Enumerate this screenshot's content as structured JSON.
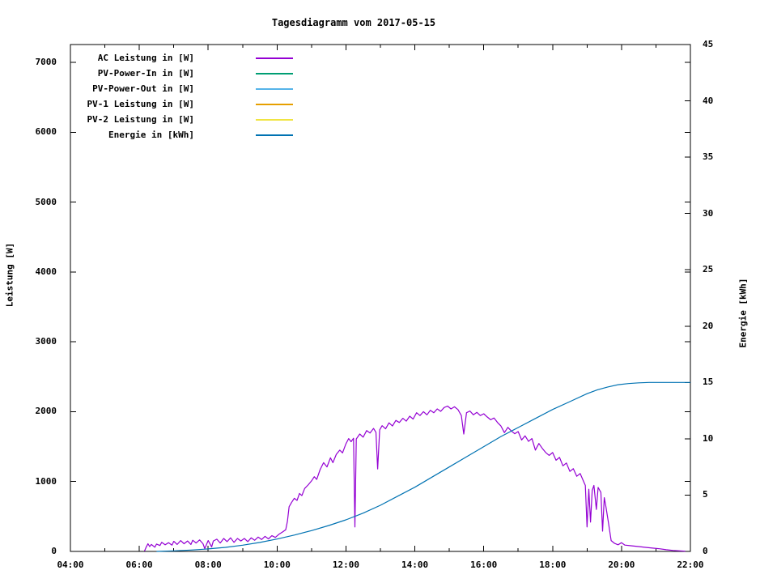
{
  "chart_data": {
    "type": "line",
    "title": "Tagesdiagramm vom 2017-05-15",
    "grid": false,
    "legend_position": "inside top-left",
    "x_axis": {
      "unit": "time of day",
      "range_hours": [
        4,
        22
      ],
      "major_tick_hours": [
        4,
        6,
        8,
        10,
        12,
        14,
        16,
        18,
        20,
        22
      ],
      "major_tick_labels": [
        "04:00",
        "06:00",
        "08:00",
        "10:00",
        "12:00",
        "14:00",
        "16:00",
        "18:00",
        "20:00",
        "22:00"
      ],
      "minor_tick_every_hours": 1
    },
    "y_axis_left": {
      "label": "Leistung [W]",
      "range": [
        0,
        7250
      ],
      "tick_values": [
        0,
        1000,
        2000,
        3000,
        4000,
        5000,
        6000,
        7000
      ]
    },
    "y_axis_right": {
      "label": "Energie [kWh]",
      "range": [
        0,
        45
      ],
      "tick_values": [
        0,
        5,
        10,
        15,
        20,
        25,
        30,
        35,
        40,
        45
      ]
    },
    "series": [
      {
        "name": "AC Leistung in [W]",
        "color": "#9400d3",
        "axis": "left",
        "visible": true,
        "points": [
          [
            6.15,
            5
          ],
          [
            6.2,
            60
          ],
          [
            6.25,
            110
          ],
          [
            6.3,
            70
          ],
          [
            6.35,
            100
          ],
          [
            6.45,
            60
          ],
          [
            6.5,
            105
          ],
          [
            6.6,
            85
          ],
          [
            6.65,
            130
          ],
          [
            6.75,
            95
          ],
          [
            6.85,
            125
          ],
          [
            6.95,
            90
          ],
          [
            7.0,
            145
          ],
          [
            7.1,
            100
          ],
          [
            7.2,
            155
          ],
          [
            7.3,
            110
          ],
          [
            7.4,
            150
          ],
          [
            7.5,
            100
          ],
          [
            7.55,
            160
          ],
          [
            7.65,
            120
          ],
          [
            7.75,
            165
          ],
          [
            7.85,
            110
          ],
          [
            7.9,
            40
          ],
          [
            8.0,
            155
          ],
          [
            8.1,
            65
          ],
          [
            8.15,
            150
          ],
          [
            8.25,
            175
          ],
          [
            8.35,
            120
          ],
          [
            8.45,
            185
          ],
          [
            8.55,
            140
          ],
          [
            8.65,
            195
          ],
          [
            8.75,
            130
          ],
          [
            8.85,
            185
          ],
          [
            8.95,
            150
          ],
          [
            9.05,
            185
          ],
          [
            9.15,
            140
          ],
          [
            9.25,
            195
          ],
          [
            9.35,
            160
          ],
          [
            9.45,
            205
          ],
          [
            9.55,
            170
          ],
          [
            9.65,
            215
          ],
          [
            9.75,
            180
          ],
          [
            9.85,
            225
          ],
          [
            9.95,
            200
          ],
          [
            10.05,
            245
          ],
          [
            10.15,
            275
          ],
          [
            10.25,
            310
          ],
          [
            10.3,
            430
          ],
          [
            10.35,
            640
          ],
          [
            10.42,
            700
          ],
          [
            10.5,
            760
          ],
          [
            10.58,
            730
          ],
          [
            10.65,
            830
          ],
          [
            10.72,
            800
          ],
          [
            10.8,
            900
          ],
          [
            10.9,
            950
          ],
          [
            11.0,
            1010
          ],
          [
            11.08,
            1070
          ],
          [
            11.15,
            1030
          ],
          [
            11.25,
            1170
          ],
          [
            11.35,
            1270
          ],
          [
            11.45,
            1210
          ],
          [
            11.55,
            1340
          ],
          [
            11.62,
            1270
          ],
          [
            11.72,
            1390
          ],
          [
            11.82,
            1450
          ],
          [
            11.9,
            1410
          ],
          [
            12.0,
            1540
          ],
          [
            12.08,
            1615
          ],
          [
            12.15,
            1570
          ],
          [
            12.22,
            1620
          ],
          [
            12.26,
            350
          ],
          [
            12.3,
            1610
          ],
          [
            12.4,
            1680
          ],
          [
            12.5,
            1635
          ],
          [
            12.6,
            1730
          ],
          [
            12.7,
            1695
          ],
          [
            12.8,
            1760
          ],
          [
            12.87,
            1705
          ],
          [
            12.92,
            1180
          ],
          [
            12.98,
            1740
          ],
          [
            13.05,
            1800
          ],
          [
            13.15,
            1755
          ],
          [
            13.25,
            1840
          ],
          [
            13.35,
            1795
          ],
          [
            13.45,
            1875
          ],
          [
            13.55,
            1845
          ],
          [
            13.65,
            1905
          ],
          [
            13.75,
            1865
          ],
          [
            13.85,
            1935
          ],
          [
            13.95,
            1895
          ],
          [
            14.05,
            1985
          ],
          [
            14.15,
            1945
          ],
          [
            14.25,
            2000
          ],
          [
            14.35,
            1955
          ],
          [
            14.45,
            2020
          ],
          [
            14.55,
            1985
          ],
          [
            14.65,
            2040
          ],
          [
            14.75,
            2005
          ],
          [
            14.85,
            2060
          ],
          [
            14.95,
            2080
          ],
          [
            15.05,
            2040
          ],
          [
            15.15,
            2070
          ],
          [
            15.25,
            2030
          ],
          [
            15.35,
            1945
          ],
          [
            15.42,
            1680
          ],
          [
            15.5,
            1985
          ],
          [
            15.6,
            2010
          ],
          [
            15.7,
            1955
          ],
          [
            15.8,
            1990
          ],
          [
            15.9,
            1945
          ],
          [
            16.0,
            1970
          ],
          [
            16.1,
            1925
          ],
          [
            16.2,
            1885
          ],
          [
            16.3,
            1910
          ],
          [
            16.4,
            1845
          ],
          [
            16.5,
            1795
          ],
          [
            16.6,
            1700
          ],
          [
            16.7,
            1775
          ],
          [
            16.8,
            1725
          ],
          [
            16.9,
            1685
          ],
          [
            17.0,
            1715
          ],
          [
            17.1,
            1595
          ],
          [
            17.2,
            1655
          ],
          [
            17.3,
            1575
          ],
          [
            17.4,
            1615
          ],
          [
            17.5,
            1450
          ],
          [
            17.6,
            1545
          ],
          [
            17.7,
            1475
          ],
          [
            17.8,
            1415
          ],
          [
            17.9,
            1375
          ],
          [
            18.0,
            1415
          ],
          [
            18.1,
            1305
          ],
          [
            18.2,
            1345
          ],
          [
            18.3,
            1225
          ],
          [
            18.4,
            1265
          ],
          [
            18.5,
            1145
          ],
          [
            18.6,
            1185
          ],
          [
            18.7,
            1075
          ],
          [
            18.8,
            1115
          ],
          [
            18.9,
            1000
          ],
          [
            18.95,
            945
          ],
          [
            19.0,
            350
          ],
          [
            19.05,
            890
          ],
          [
            19.1,
            420
          ],
          [
            19.15,
            875
          ],
          [
            19.2,
            945
          ],
          [
            19.27,
            600
          ],
          [
            19.32,
            915
          ],
          [
            19.4,
            845
          ],
          [
            19.45,
            290
          ],
          [
            19.5,
            770
          ],
          [
            19.55,
            635
          ],
          [
            19.62,
            415
          ],
          [
            19.7,
            155
          ],
          [
            19.8,
            115
          ],
          [
            19.9,
            95
          ],
          [
            20.0,
            125
          ],
          [
            20.1,
            90
          ],
          [
            20.3,
            80
          ],
          [
            20.5,
            70
          ],
          [
            20.7,
            58
          ],
          [
            20.9,
            48
          ],
          [
            21.1,
            38
          ],
          [
            21.3,
            24
          ],
          [
            21.5,
            14
          ],
          [
            21.7,
            8
          ],
          [
            21.85,
            4
          ]
        ]
      },
      {
        "name": "PV-Power-In in [W]",
        "color": "#009e73",
        "axis": "left",
        "visible": false,
        "note": "no visible trace (stays at 0 W along the x-axis)",
        "points": []
      },
      {
        "name": "PV-Power-Out in [W]",
        "color": "#56b4e9",
        "axis": "left",
        "visible": false,
        "note": "no visible trace (stays at 0 W along the x-axis)",
        "points": []
      },
      {
        "name": "PV-1 Leistung in [W]",
        "color": "#e69f00",
        "axis": "left",
        "visible": false,
        "note": "no visible trace (stays at 0 W along the x-axis)",
        "points": []
      },
      {
        "name": "PV-2 Leistung in [W]",
        "color": "#f0e442",
        "axis": "left",
        "visible": false,
        "note": "no visible trace (stays at 0 W along the x-axis)",
        "points": []
      },
      {
        "name": "Energie in [kWh]",
        "color": "#0072b2",
        "axis": "right",
        "visible": true,
        "points": [
          [
            6.5,
            0
          ],
          [
            7.0,
            0.05
          ],
          [
            7.5,
            0.12
          ],
          [
            8.0,
            0.22
          ],
          [
            8.5,
            0.36
          ],
          [
            9.0,
            0.55
          ],
          [
            9.5,
            0.8
          ],
          [
            10.0,
            1.1
          ],
          [
            10.5,
            1.45
          ],
          [
            11.0,
            1.85
          ],
          [
            11.5,
            2.3
          ],
          [
            12.0,
            2.8
          ],
          [
            12.5,
            3.4
          ],
          [
            13.0,
            4.1
          ],
          [
            13.5,
            4.9
          ],
          [
            14.0,
            5.7
          ],
          [
            14.5,
            6.6
          ],
          [
            15.0,
            7.5
          ],
          [
            15.5,
            8.4
          ],
          [
            16.0,
            9.3
          ],
          [
            16.5,
            10.2
          ],
          [
            17.0,
            11.0
          ],
          [
            17.5,
            11.8
          ],
          [
            18.0,
            12.6
          ],
          [
            18.5,
            13.3
          ],
          [
            19.0,
            14.0
          ],
          [
            19.3,
            14.35
          ],
          [
            19.6,
            14.6
          ],
          [
            19.9,
            14.8
          ],
          [
            20.2,
            14.9
          ],
          [
            20.5,
            14.97
          ],
          [
            20.8,
            15.0
          ],
          [
            21.2,
            15.0
          ],
          [
            21.6,
            15.0
          ],
          [
            22.0,
            15.0
          ]
        ]
      }
    ]
  }
}
